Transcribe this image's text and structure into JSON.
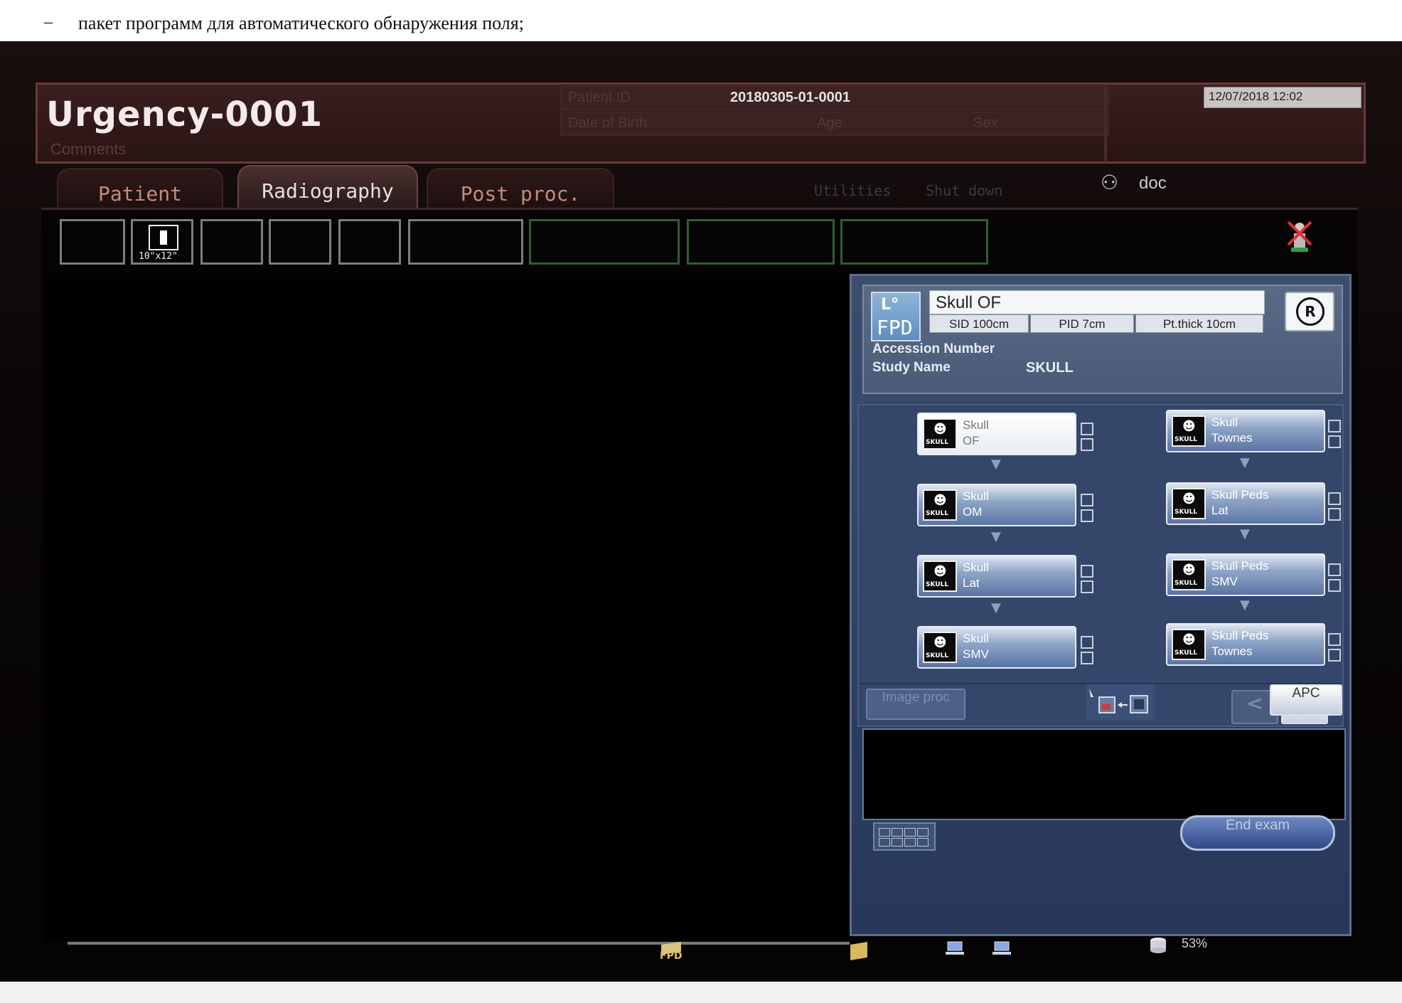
{
  "doc_caption": {
    "dash": "–",
    "text": "пакет программ для автоматического обнаружения поля;"
  },
  "header": {
    "title": "Urgency-0001",
    "comments_label": "Comments",
    "patient_id_label": "Patient ID",
    "patient_id": "20180305-01-0001",
    "dob_label": "Date of Birth",
    "age_label": "Age",
    "sex_label": "Sex",
    "datetime": "12/07/2018 12:02"
  },
  "tabs": [
    {
      "label": "Patient",
      "active": false
    },
    {
      "label": "Radiography",
      "active": true
    },
    {
      "label": "Post proc.",
      "active": false
    }
  ],
  "utilities": {
    "utilities_label": "Utilities",
    "shutdown_label": "Shut down"
  },
  "user": {
    "icon": "user-icon",
    "name": "doc"
  },
  "thumbnails": {
    "cassette_label": "10\"x12\""
  },
  "exam_info": {
    "detector_label": "FPD",
    "exam_name": "Skull OF",
    "sid": "SID 100cm",
    "pid": "PID   7cm",
    "pt_thick": "Pt.thick 10cm",
    "orientation": "R",
    "accession_label": "Accession Number",
    "study_label": "Study Name",
    "study_value": "SKULL"
  },
  "protocols": {
    "left": [
      {
        "line1": "Skull",
        "line2": "OF",
        "selected": true
      },
      {
        "line1": "Skull",
        "line2": "OM",
        "selected": false
      },
      {
        "line1": "Skull",
        "line2": "Lat",
        "selected": false
      },
      {
        "line1": "Skull",
        "line2": "SMV",
        "selected": false
      }
    ],
    "right": [
      {
        "line1": "Skull",
        "line2": "Townes",
        "selected": false
      },
      {
        "line1": "Skull Peds",
        "line2": "Lat",
        "selected": false
      },
      {
        "line1": "Skull Peds",
        "line2": "SMV",
        "selected": false
      },
      {
        "line1": "Skull Peds",
        "line2": "Townes",
        "selected": false
      }
    ],
    "icon_text": "SKULL"
  },
  "nav": {
    "prev": "<",
    "next": ">"
  },
  "actions": {
    "image_proc": "Image proc",
    "apc": "APC",
    "end_exam": "End exam"
  },
  "status": {
    "fpd_label": "FPD",
    "disk_percent": "53%"
  }
}
